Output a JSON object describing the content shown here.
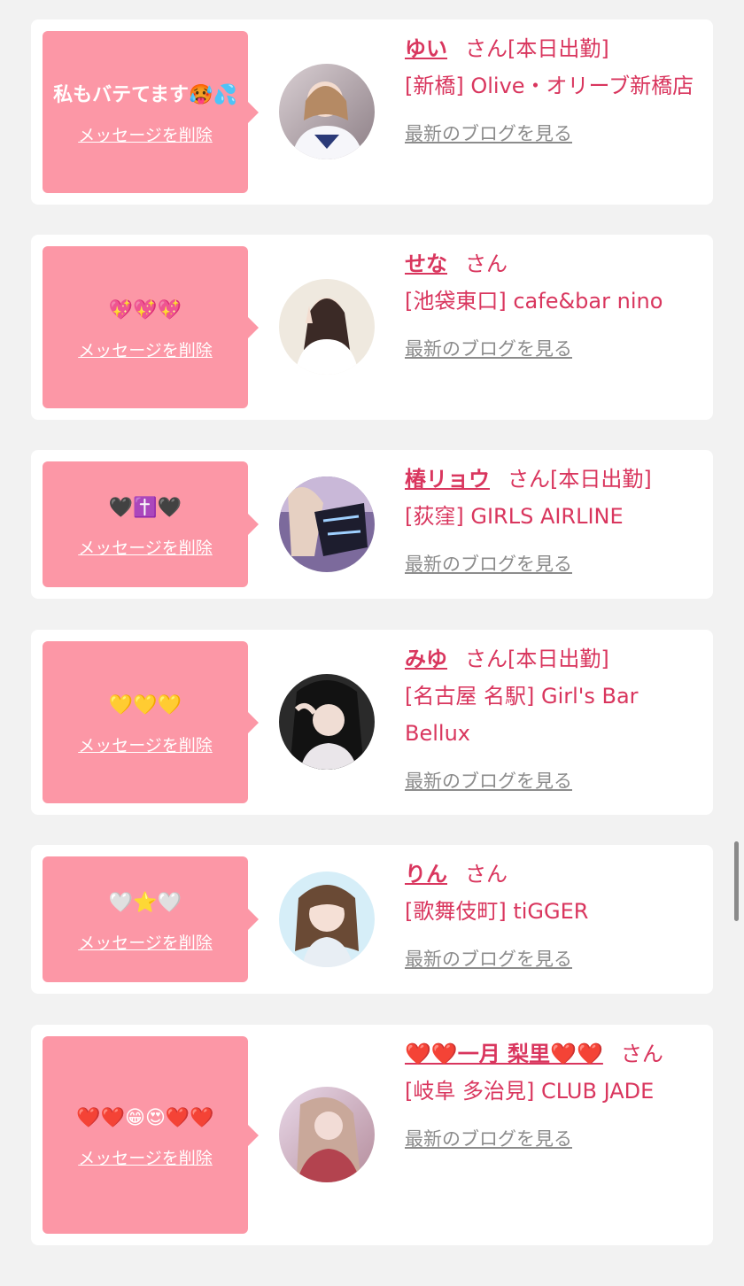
{
  "colors": {
    "background": "#f2f2f2",
    "bubble": "#fc97a6",
    "accent": "#d9365e",
    "link_gray": "#8c8c8c"
  },
  "entries": [
    {
      "message": "私もバテてます🥵💦",
      "delete_label": "メッセージを削除",
      "name": "ゆい",
      "suffix": "さん[本日出勤]",
      "shop": "[新橋] Olive・オリーブ新橋店",
      "blog_label": "最新のブログを見る"
    },
    {
      "message": "💖💖💖",
      "delete_label": "メッセージを削除",
      "name": "せな",
      "suffix": "さん",
      "shop": "[池袋東口] cafe&bar nino",
      "blog_label": "最新のブログを見る"
    },
    {
      "message": "🖤✝️🖤",
      "delete_label": "メッセージを削除",
      "name": "椿リョウ",
      "suffix": "さん[本日出勤]",
      "shop": "[荻窪] GIRLS AIRLINE",
      "blog_label": "最新のブログを見る"
    },
    {
      "message": "💛💛💛",
      "delete_label": "メッセージを削除",
      "name": "みゆ",
      "suffix": "さん[本日出勤]",
      "shop": "[名古屋 名駅] Girl's Bar Bellux",
      "blog_label": "最新のブログを見る"
    },
    {
      "message": "🤍⭐🤍",
      "delete_label": "メッセージを削除",
      "name": "りん",
      "suffix": "さん",
      "shop": "[歌舞伎町] tiGGER",
      "blog_label": "最新のブログを見る"
    },
    {
      "message": "❤️❤️😁😍❤️❤️",
      "delete_label": "メッセージを削除",
      "name": "❤️❤️一月 梨里❤️❤️",
      "suffix": "さん",
      "shop": "[岐阜 多治見] CLUB JADE",
      "blog_label": "最新のブログを見る"
    }
  ]
}
